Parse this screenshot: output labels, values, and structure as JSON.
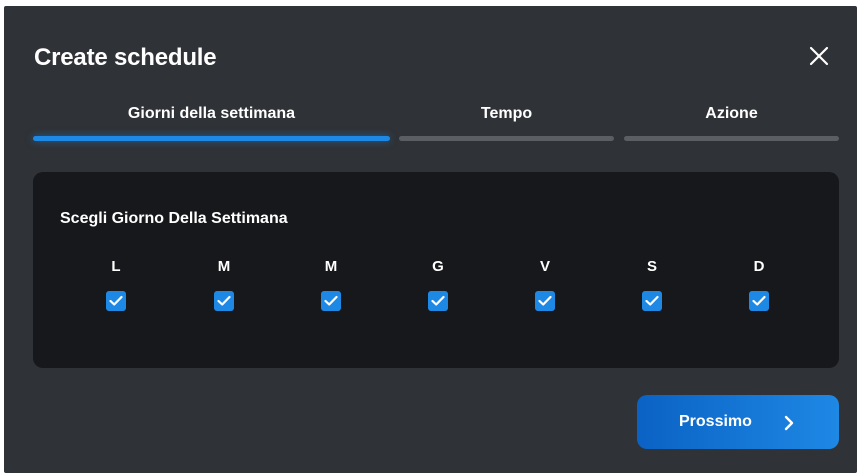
{
  "dialog": {
    "title": "Create schedule",
    "close_icon": "close-icon"
  },
  "steps": [
    {
      "label": "Giorni della settimana",
      "active": true
    },
    {
      "label": "Tempo",
      "active": false
    },
    {
      "label": "Azione",
      "active": false
    }
  ],
  "panel": {
    "title": "Scegli Giorno Della Settimana",
    "days": [
      {
        "label": "L",
        "checked": true
      },
      {
        "label": "M",
        "checked": true
      },
      {
        "label": "M",
        "checked": true
      },
      {
        "label": "G",
        "checked": true
      },
      {
        "label": "V",
        "checked": true
      },
      {
        "label": "S",
        "checked": true
      },
      {
        "label": "D",
        "checked": true
      }
    ]
  },
  "footer": {
    "next_label": "Prossimo",
    "next_icon": "chevron-right-icon"
  },
  "colors": {
    "accent": "#1e88e5",
    "dialog_bg": "#2f3236",
    "panel_bg": "#16181b",
    "inactive_bar": "#5b5f64"
  }
}
